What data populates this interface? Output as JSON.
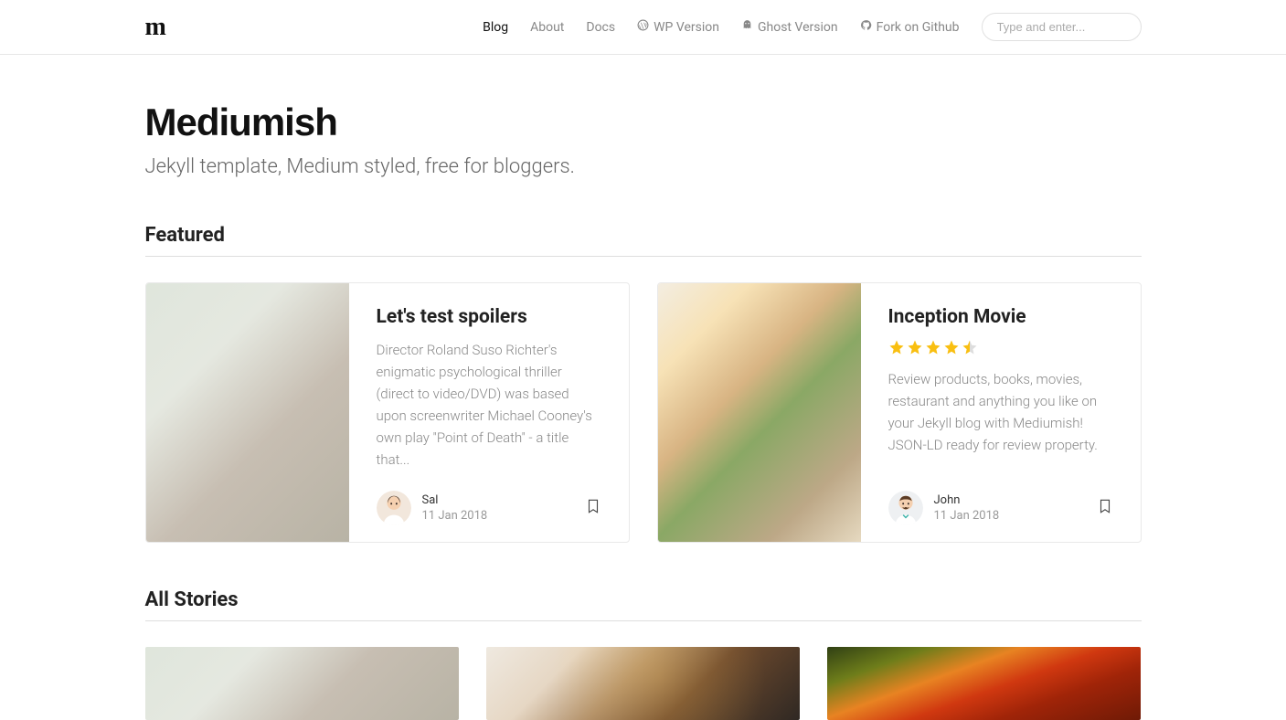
{
  "nav": {
    "logo": "m",
    "links": [
      {
        "label": "Blog",
        "active": true
      },
      {
        "label": "About"
      },
      {
        "label": "Docs"
      },
      {
        "label": "WP Version",
        "icon": "wordpress"
      },
      {
        "label": "Ghost Version",
        "icon": "ghost"
      },
      {
        "label": "Fork on Github",
        "icon": "github"
      }
    ],
    "search_placeholder": "Type and enter..."
  },
  "hero": {
    "title": "Mediumish",
    "subtitle": "Jekyll template, Medium styled, free for bloggers."
  },
  "sections": {
    "featured": "Featured",
    "all_stories": "All Stories"
  },
  "featured": [
    {
      "title": "Let's test spoilers",
      "excerpt": "Director Roland Suso Richter's enigmatic psychological thriller (direct to video/DVD) was based upon screenwriter Michael Cooney's own play \"Point of Death\" - a title that...",
      "author": "Sal",
      "date": "11 Jan 2018",
      "rating": null
    },
    {
      "title": "Inception Movie",
      "excerpt": "Review products, books, movies, restaurant and anything you like on your Jekyll blog with Mediumish! JSON-LD ready for review property.",
      "author": "John",
      "date": "11 Jan 2018",
      "rating": 4.5
    }
  ]
}
